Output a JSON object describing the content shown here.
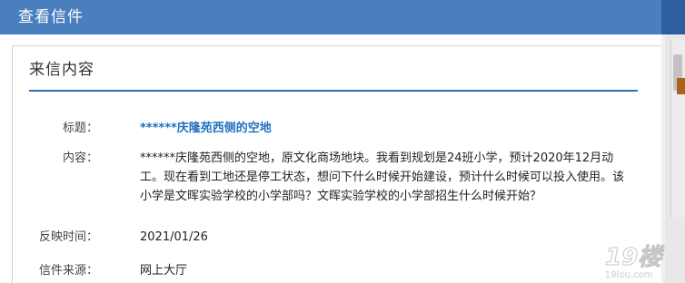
{
  "modal": {
    "title": "查看信件"
  },
  "section": {
    "heading": "来信内容"
  },
  "fields": {
    "subject_label": "标题：",
    "subject_value": "******庆隆苑西侧的空地",
    "content_label": "内容：",
    "content_value": "******庆隆苑西侧的空地，原文化商场地块。我看到规划是24班小学，预计2020年12月动工。现在看到工地还是停工状态，想问下什么时候开始建设，预计什么时候可以投入使用。该小学是文晖实验学校的小学部吗？文晖实验学校的小学部招生什么时候开始？",
    "date_label": "反映时间：",
    "date_value": "2021/01/26",
    "source_label": "信件来源：",
    "source_value": "网上大厅"
  },
  "watermark": {
    "brand": "19楼",
    "domain": "19lou.com"
  },
  "colors": {
    "header_bg": "#4a7fbe",
    "accent_rule": "#2f6fb5",
    "link": "#1f6fbf"
  }
}
